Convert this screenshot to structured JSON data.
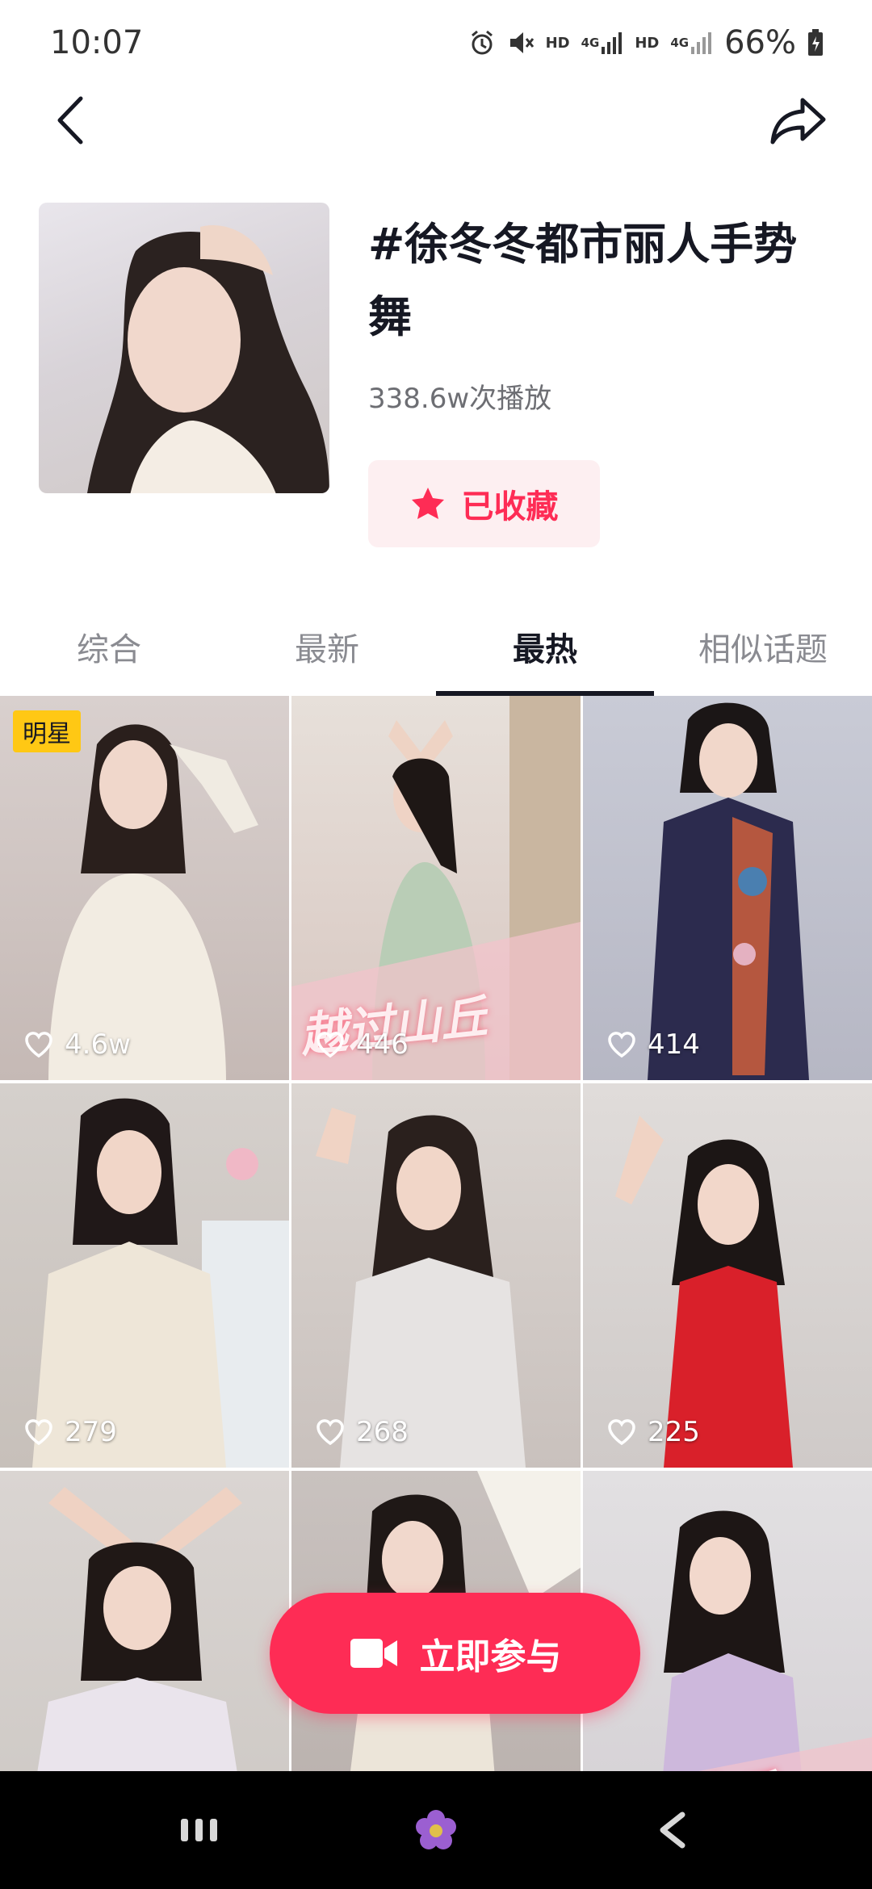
{
  "status_bar": {
    "time": "10:07",
    "hd1": "HD",
    "net1": "4G",
    "hd2": "HD",
    "net2": "4G",
    "battery": "66%"
  },
  "header": {
    "title": "#徐冬冬都市丽人手势舞",
    "plays": "338.6w次播放",
    "favorite_label": "已收藏"
  },
  "tabs": [
    {
      "label": "综合",
      "active": false
    },
    {
      "label": "最新",
      "active": false
    },
    {
      "label": "最热",
      "active": true
    },
    {
      "label": "相似话题",
      "active": false
    }
  ],
  "grid": {
    "badge": "明星",
    "overlay_text_1": "越过山丘",
    "overlay_text_2": "越过山丘",
    "items": [
      {
        "likes": "4.6w"
      },
      {
        "likes": "446"
      },
      {
        "likes": "414"
      },
      {
        "likes": "279"
      },
      {
        "likes": "268"
      },
      {
        "likes": "225"
      },
      {
        "likes": ""
      },
      {
        "likes": ""
      },
      {
        "likes": ""
      }
    ]
  },
  "join_button": {
    "label": "立即参与"
  },
  "colors": {
    "accent": "#fe2c55",
    "badge": "#ffc814",
    "text": "#161823",
    "muted": "#8a8b91"
  },
  "icons": {
    "back": "chevron-left-icon",
    "share": "share-arrow-icon",
    "star": "star-icon",
    "heart": "heart-icon",
    "camera": "video-camera-icon"
  }
}
